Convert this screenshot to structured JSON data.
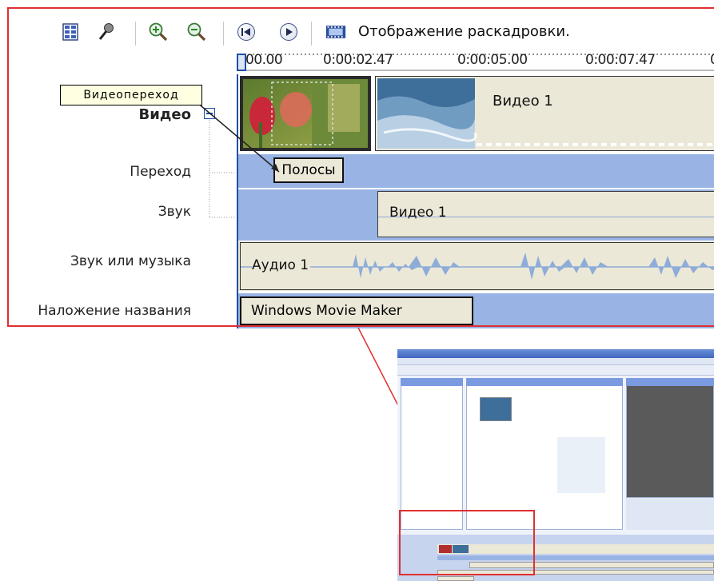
{
  "toolbar": {
    "icons": [
      "storyboard-grid-icon",
      "narration-microphone-icon",
      "zoom-in-icon",
      "zoom-out-icon",
      "rewind-icon",
      "play-icon",
      "filmstrip-icon"
    ],
    "storyboard_label": "Отображение раскадровки."
  },
  "ruler": {
    "ticks": [
      "00.00",
      "0:00:02.47",
      "0:00:05.00",
      "0:00:07.47",
      "0"
    ]
  },
  "tooltip": {
    "text": "Видеопереход"
  },
  "tracks": {
    "video": {
      "label": "Видео",
      "clip_label": "Видео 1"
    },
    "transition": {
      "label": "Переход",
      "clip_label": "Полосы"
    },
    "audio": {
      "label": "Звук",
      "clip_label": "Видео 1"
    },
    "music": {
      "label": "Звук или музыка",
      "clip_label": "Аудио 1"
    },
    "title": {
      "label": "Наложение названия",
      "clip_label": "Windows Movie Maker"
    }
  },
  "colors": {
    "highlight_frame": "#e03030",
    "lane_blue": "#99b4e4",
    "clip_beige": "#ebe8d8",
    "wave_blue": "#8eacd8",
    "cursor_blue": "#1f4fa8",
    "tooltip_bg": "#ffffe1"
  }
}
